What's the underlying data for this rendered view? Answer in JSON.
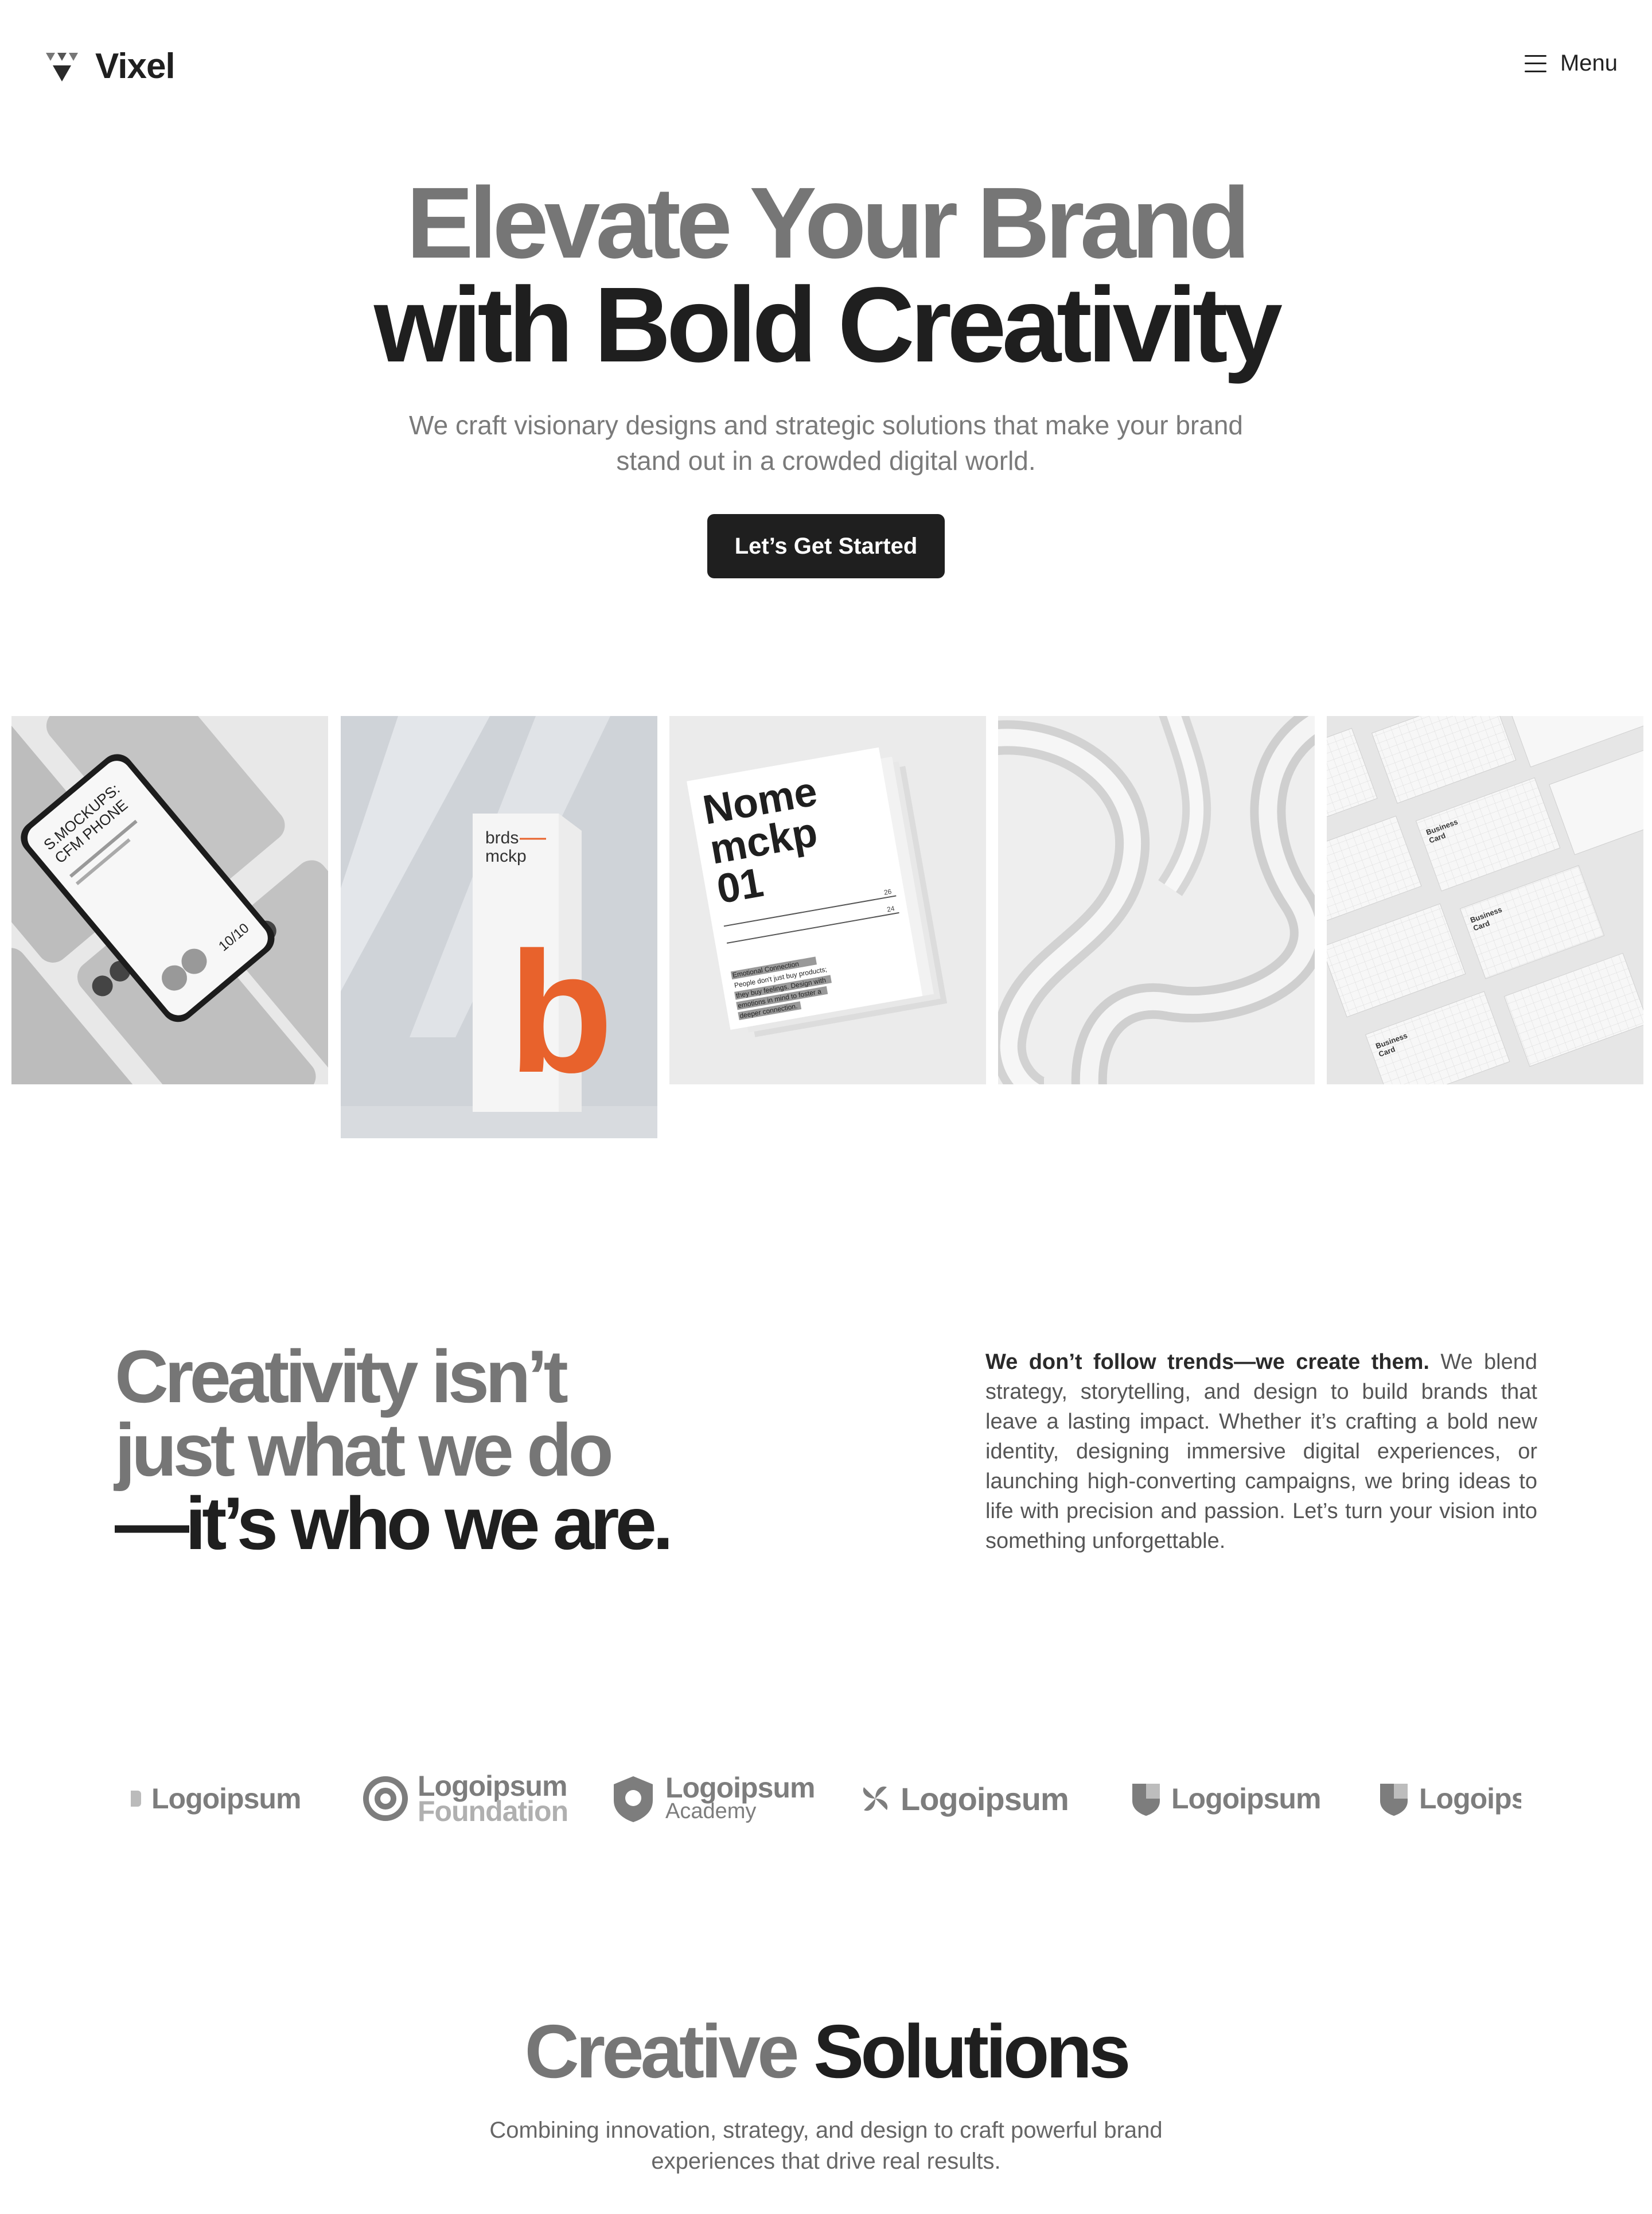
{
  "brand": {
    "name": "Vixel"
  },
  "nav": {
    "menu_label": "Menu",
    "menu_icon": "hamburger-icon"
  },
  "hero": {
    "title_line1": "Elevate Your Brand",
    "title_line2": "with Bold Creativity",
    "subtitle": "We craft visionary designs and strategic solutions that make your brand stand out in a crowded digital world.",
    "cta_label": "Let’s Get Started"
  },
  "gallery": {
    "phone": {
      "lines": [
        "S.MOCKUPS:",
        "CFM PHONE"
      ],
      "date": "10/10"
    },
    "stand": {
      "line1": "brds",
      "line2": "mckp",
      "letter": "b",
      "accent": "#e8622c"
    },
    "poster": {
      "line1": "Nome",
      "line2": "mckp",
      "line3": "01",
      "n1": "26",
      "n2": "24",
      "caption": [
        "Emotional Connection",
        "People don't just buy products;",
        "they buy feelings. Design with",
        "emotions in mind to foster a",
        "deeper connection."
      ]
    },
    "cards": {
      "label1": "Business",
      "label2": "Card"
    }
  },
  "about": {
    "title_line1": "Creativity isn’t",
    "title_line2": "just what we do",
    "title_line3": "—it’s who we are.",
    "lead": "We don’t follow trends—we create them.",
    "body": " We blend strategy, storytelling, and design to build brands that leave a lasting impact. Whether it’s crafting a bold new identity, designing immersive digital experiences, or launching high-converting campaigns, we bring ideas to life with precision and passion. Let’s turn your vision into something unforgettable."
  },
  "logos": [
    {
      "name": "Logoipsum",
      "sub": ""
    },
    {
      "name": "Logoipsum",
      "sub": "Foundation"
    },
    {
      "name": "Logoipsum",
      "sub": "Academy"
    },
    {
      "name": "Logoipsum",
      "sub": ""
    },
    {
      "name": "Logoipsum",
      "sub": ""
    },
    {
      "name": "Logoipsum",
      "sub": ""
    }
  ],
  "solutions": {
    "title_gray": "Creative",
    "title_dark": "Solutions",
    "subtitle": "Combining innovation, strategy, and design to craft powerful brand experiences that drive real results."
  }
}
